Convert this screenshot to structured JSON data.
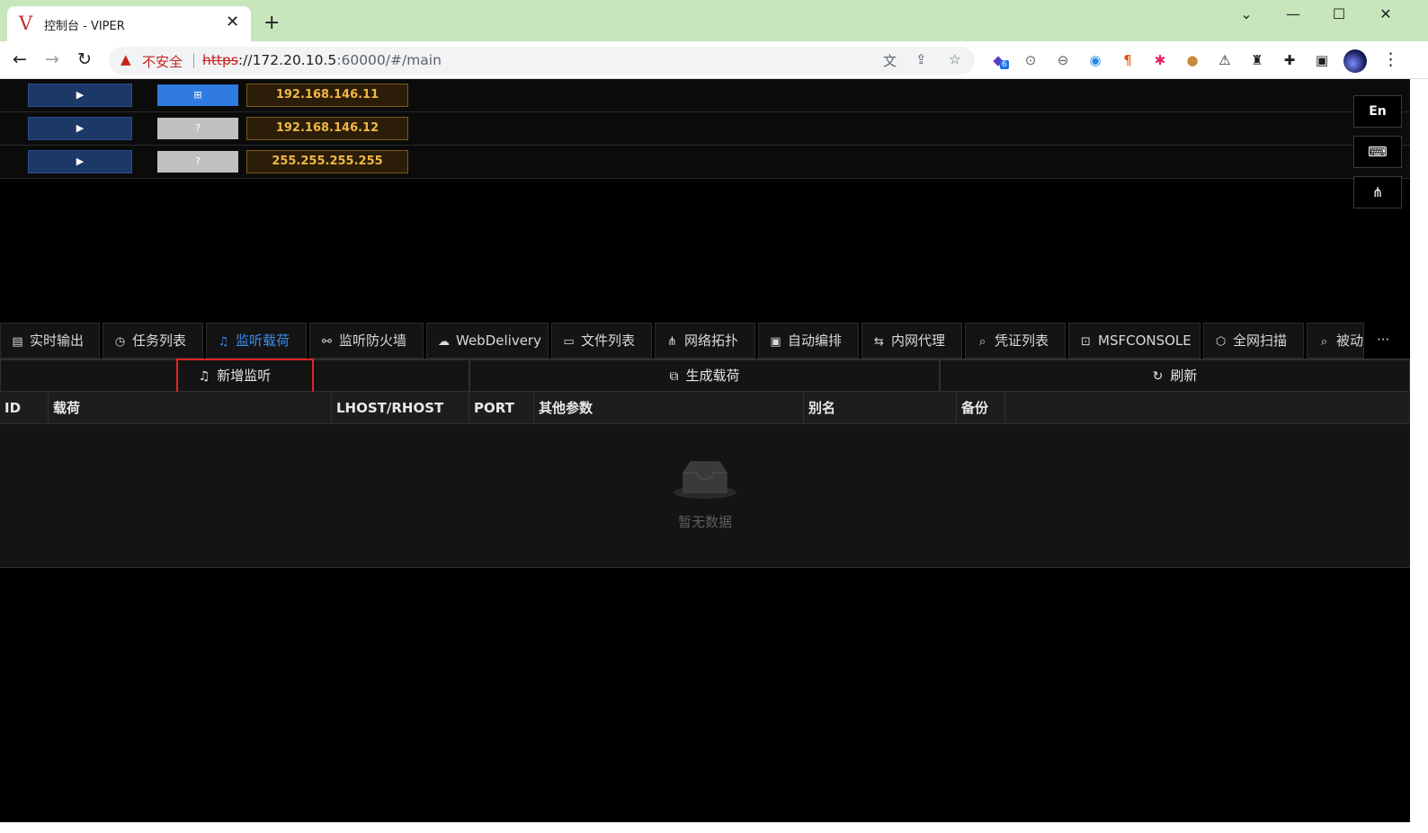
{
  "browser": {
    "tab_title": "控制台 - VIPER",
    "favicon": "V",
    "insecure_label": "不安全",
    "url_scheme": "https",
    "url_host": "://172.20.10.5",
    "url_rest": ":60000/#/main",
    "extension_badge": "6"
  },
  "hosts": [
    {
      "os": "⊞",
      "os_style": "blue",
      "ip": "192.168.146.11"
    },
    {
      "os": "?",
      "os_style": "grey",
      "ip": "192.168.146.12"
    },
    {
      "os": "?",
      "os_style": "grey",
      "ip": "255.255.255.255"
    }
  ],
  "side": {
    "lang_label": "En"
  },
  "tabs": [
    {
      "icon": "dashboard-icon",
      "label": "实时输出"
    },
    {
      "icon": "history-icon",
      "label": "任务列表"
    },
    {
      "icon": "headphones-icon",
      "label": "监听载荷"
    },
    {
      "icon": "disconnect-icon",
      "label": "监听防火墙"
    },
    {
      "icon": "cloud-upload-icon",
      "label": "WebDelivery"
    },
    {
      "icon": "folder-icon",
      "label": "文件列表"
    },
    {
      "icon": "topology-icon",
      "label": "网络拓扑"
    },
    {
      "icon": "robot-icon",
      "label": "自动编排"
    },
    {
      "icon": "proxy-icon",
      "label": "内网代理"
    },
    {
      "icon": "search-icon",
      "label": "凭证列表"
    },
    {
      "icon": "terminal-icon",
      "label": "MSFCONSOLE"
    },
    {
      "icon": "scan-icon",
      "label": "全网扫描"
    },
    {
      "icon": "file-search-icon",
      "label": "被动"
    }
  ],
  "active_tab": "监听载荷",
  "tab_more": "···",
  "actions": {
    "add_listener": "新增监听",
    "generate_payload": "生成载荷",
    "refresh": "刷新"
  },
  "table": {
    "columns": [
      "ID",
      "载荷",
      "LHOST/RHOST",
      "PORT",
      "其他参数",
      "别名",
      "备份"
    ],
    "rows": [],
    "empty_text": "暂无数据"
  }
}
